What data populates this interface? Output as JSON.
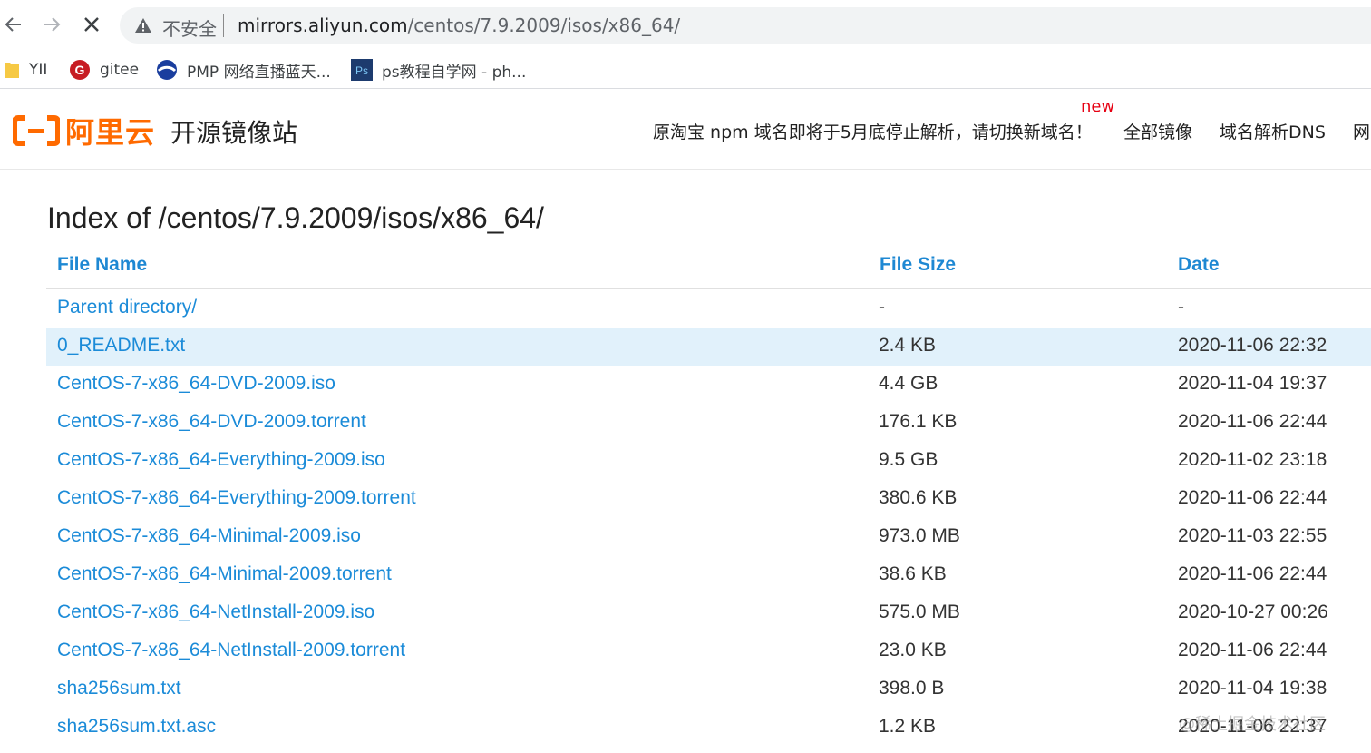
{
  "browser": {
    "insecure_label": "不安全",
    "url_host": "mirrors.aliyun.com",
    "url_path": "/centos/7.9.2009/isos/x86_64/",
    "bookmarks": [
      {
        "label": "YII",
        "icon": "folder-icon"
      },
      {
        "label": "gitee",
        "icon": "gitee-icon"
      },
      {
        "label": "PMP 网络直播蓝天...",
        "icon": "pmp-icon"
      },
      {
        "label": "ps教程自学网 - ph...",
        "icon": "ps-icon"
      }
    ]
  },
  "site": {
    "logo_text": "阿里云",
    "title": "开源镜像站",
    "notice": "原淘宝 npm 域名即将于5月底停止解析，请切换新域名！",
    "new_badge": "new",
    "nav": [
      "全部镜像",
      "域名解析DNS",
      "网"
    ]
  },
  "index": {
    "title": "Index of /centos/7.9.2009/isos/x86_64/",
    "columns": [
      "File Name",
      "File Size",
      "Date"
    ],
    "rows": [
      {
        "name": "Parent directory/",
        "size": "-",
        "date": "-"
      },
      {
        "name": "0_README.txt",
        "size": "2.4 KB",
        "date": "2020-11-06 22:32"
      },
      {
        "name": "CentOS-7-x86_64-DVD-2009.iso",
        "size": "4.4 GB",
        "date": "2020-11-04 19:37"
      },
      {
        "name": "CentOS-7-x86_64-DVD-2009.torrent",
        "size": "176.1 KB",
        "date": "2020-11-06 22:44"
      },
      {
        "name": "CentOS-7-x86_64-Everything-2009.iso",
        "size": "9.5 GB",
        "date": "2020-11-02 23:18"
      },
      {
        "name": "CentOS-7-x86_64-Everything-2009.torrent",
        "size": "380.6 KB",
        "date": "2020-11-06 22:44"
      },
      {
        "name": "CentOS-7-x86_64-Minimal-2009.iso",
        "size": "973.0 MB",
        "date": "2020-11-03 22:55"
      },
      {
        "name": "CentOS-7-x86_64-Minimal-2009.torrent",
        "size": "38.6 KB",
        "date": "2020-11-06 22:44"
      },
      {
        "name": "CentOS-7-x86_64-NetInstall-2009.iso",
        "size": "575.0 MB",
        "date": "2020-10-27 00:26"
      },
      {
        "name": "CentOS-7-x86_64-NetInstall-2009.torrent",
        "size": "23.0 KB",
        "date": "2020-11-06 22:44"
      },
      {
        "name": "sha256sum.txt",
        "size": "398.0 B",
        "date": "2020-11-04 19:38"
      },
      {
        "name": "sha256sum.txt.asc",
        "size": "1.2 KB",
        "date": "2020-11-06 22:37"
      }
    ]
  },
  "watermark": "@稀土掘金技术社区",
  "colors": {
    "accent": "#ff6a00",
    "link": "#1b8bd8",
    "highlight_row": "#e1f1fb",
    "new_badge": "#e60012"
  }
}
